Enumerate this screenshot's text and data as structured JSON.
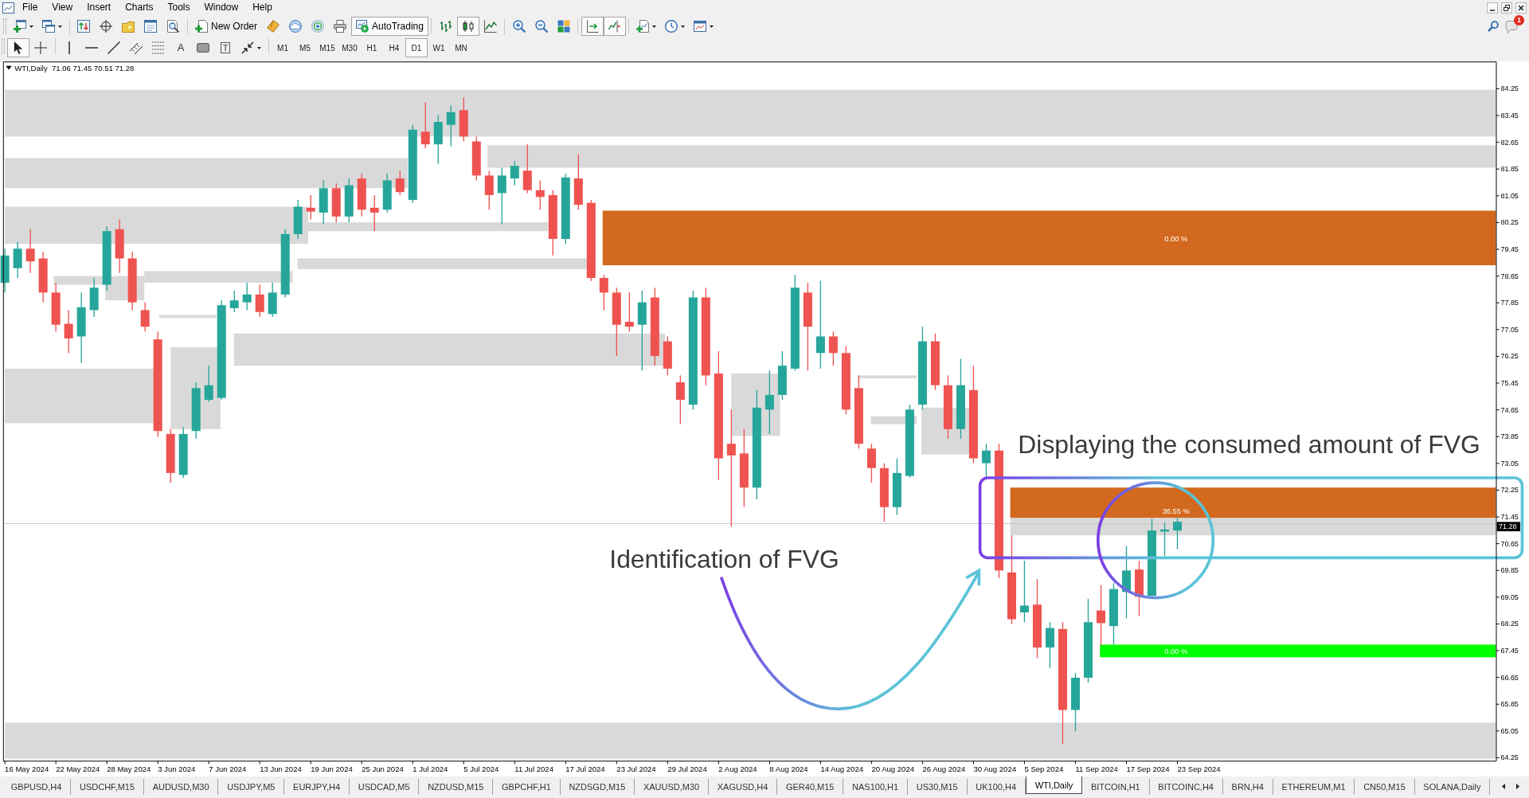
{
  "menu_bar": {
    "items": [
      "File",
      "View",
      "Insert",
      "Charts",
      "Tools",
      "Window",
      "Help"
    ]
  },
  "toolbar": {
    "new_order": {
      "label": "New Order"
    },
    "autotrading": {
      "label": "AutoTrading",
      "on": true
    },
    "chart_types": [
      {
        "kind": "bars",
        "selected": false
      },
      {
        "kind": "candles",
        "selected": true
      },
      {
        "kind": "line",
        "selected": false
      }
    ],
    "auto_scroll": {
      "on": true
    },
    "chart_shift": {
      "on": true
    },
    "notification_badge": "1"
  },
  "drawing_toolbar": {
    "pointers": [
      {
        "kind": "cursor",
        "selected": true
      },
      {
        "kind": "crosshair",
        "selected": false
      }
    ],
    "text_tool": "A",
    "text_label_tool": "T",
    "timeframes": [
      {
        "label": "M1",
        "selected": false
      },
      {
        "label": "M5",
        "selected": false
      },
      {
        "label": "M15",
        "selected": false
      },
      {
        "label": "M30",
        "selected": false
      },
      {
        "label": "H1",
        "selected": false
      },
      {
        "label": "H4",
        "selected": false
      },
      {
        "label": "D1",
        "selected": true
      },
      {
        "label": "W1",
        "selected": false
      },
      {
        "label": "MN",
        "selected": false
      }
    ]
  },
  "chart": {
    "symbol": "WTI,Daily",
    "quote": "71.06 71.45 70.51 71.28",
    "zones": [
      {
        "label": "0.00 %",
        "color": "#d2691e"
      },
      {
        "label": "36.55 %",
        "color": "#d2691e"
      },
      {
        "label": "0.00 %",
        "color": "#00ff00"
      }
    ],
    "annotations": [
      {
        "text": "Displaying the consumed amount of FVG"
      },
      {
        "text": "Identification of FVG"
      }
    ],
    "price_axis": {
      "ticks": [
        "84.25",
        "83.45",
        "82.65",
        "81.85",
        "81.05",
        "80.25",
        "79.45",
        "78.65",
        "77.85",
        "77.05",
        "76.25",
        "75.45",
        "74.65",
        "73.85",
        "73.05",
        "72.25",
        "71.45",
        "70.65",
        "69.85",
        "69.05",
        "68.25",
        "67.45",
        "66.65",
        "65.85",
        "65.05",
        "64.25"
      ],
      "current_price": "71.28"
    },
    "time_axis": {
      "labels": [
        "16 May 2024",
        "22 May 2024",
        "28 May 2024",
        "3 Jun 2024",
        "7 Jun 2024",
        "13 Jun 2024",
        "19 Jun 2024",
        "25 Jun 2024",
        "1 Jul 2024",
        "5 Jul 2024",
        "11 Jul 2024",
        "17 Jul 2024",
        "23 Jul 2024",
        "29 Jul 2024",
        "2 Aug 2024",
        "8 Aug 2024",
        "14 Aug 2024",
        "20 Aug 2024",
        "26 Aug 2024",
        "30 Aug 2024",
        "5 Sep 2024",
        "11 Sep 2024",
        "17 Sep 2024",
        "23 Sep 2024"
      ]
    }
  },
  "tabs": [
    {
      "label": "GBPUSD,H4",
      "selected": false
    },
    {
      "label": "USDCHF,M15",
      "selected": false
    },
    {
      "label": "AUDUSD,M30",
      "selected": false
    },
    {
      "label": "USDJPY,M5",
      "selected": false
    },
    {
      "label": "EURJPY,H4",
      "selected": false
    },
    {
      "label": "USDCAD,M5",
      "selected": false
    },
    {
      "label": "NZDUSD,M15",
      "selected": false
    },
    {
      "label": "GBPCHF,H1",
      "selected": false
    },
    {
      "label": "NZDSGD,M15",
      "selected": false
    },
    {
      "label": "XAUUSD,M30",
      "selected": false
    },
    {
      "label": "XAGUSD,H4",
      "selected": false
    },
    {
      "label": "GER40,M15",
      "selected": false
    },
    {
      "label": "NAS100,H1",
      "selected": false
    },
    {
      "label": "US30,M15",
      "selected": false
    },
    {
      "label": "UK100,H4",
      "selected": false
    },
    {
      "label": "WTI,Daily",
      "selected": true
    },
    {
      "label": "BITCOIN,H1",
      "selected": false
    },
    {
      "label": "BITCOINC,H4",
      "selected": false
    },
    {
      "label": "BRN,H4",
      "selected": false
    },
    {
      "label": "ETHEREUM,M1",
      "selected": false
    },
    {
      "label": "CN50,M15",
      "selected": false
    },
    {
      "label": "SOLANA,Daily",
      "selected": false
    }
  ]
}
